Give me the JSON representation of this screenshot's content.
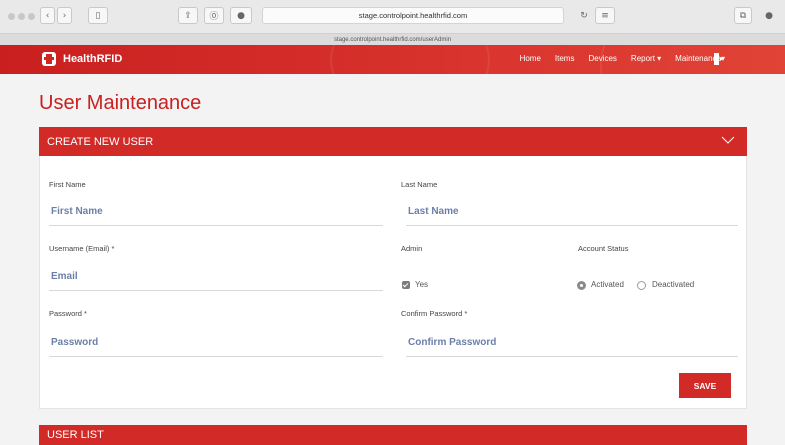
{
  "browser": {
    "url": "stage.controlpoint.healthrfid.com",
    "status_url": "stage.controlpoint.healthrfid.com/userAdmin"
  },
  "nav": {
    "brand": "HealthRFID",
    "links": [
      "Home",
      "Items",
      "Devices",
      "Report ▾",
      "Maintenance▾"
    ],
    "colors": {
      "primary": "#c9201f",
      "accent": "#d12a27"
    }
  },
  "page": {
    "title": "User Maintenance"
  },
  "create_panel": {
    "header": "CREATE NEW USER",
    "first_name": {
      "label": "First Name",
      "placeholder": "First Name"
    },
    "last_name": {
      "label": "Last Name",
      "placeholder": "Last Name"
    },
    "username": {
      "label": "Username (Email) *",
      "placeholder": "Email"
    },
    "admin": {
      "label": "Admin",
      "option": "Yes",
      "checked": true
    },
    "account_status": {
      "label": "Account Status",
      "options": [
        "Activated",
        "Deactivated"
      ],
      "selected": "Activated"
    },
    "password": {
      "label": "Password *",
      "placeholder": "Password"
    },
    "confirm_password": {
      "label": "Confirm Password *",
      "placeholder": "Confirm Password"
    },
    "save_label": "SAVE"
  },
  "user_list": {
    "header": "USER LIST"
  }
}
